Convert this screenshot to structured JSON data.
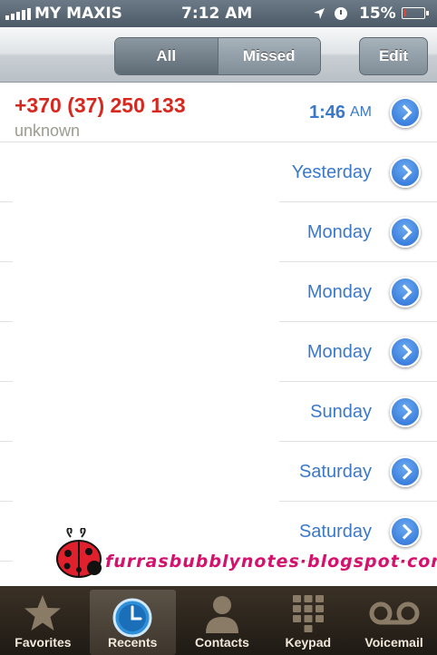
{
  "status": {
    "carrier": "MY MAXIS",
    "time": "7:12 AM",
    "battery": "15%",
    "battery_level": 0.15,
    "icons": [
      "signal-icon",
      "location-arrow-icon",
      "alarm-clock-icon",
      "battery-icon"
    ]
  },
  "nav": {
    "segments": [
      "All",
      "Missed"
    ],
    "selected": "All",
    "edit": "Edit"
  },
  "calls": [
    {
      "number": "+370 (37) 250 133",
      "label": "unknown",
      "time": "1:46",
      "ampm": "AM"
    },
    {
      "time": "Yesterday"
    },
    {
      "time": "Monday"
    },
    {
      "time": "Monday"
    },
    {
      "time": "Monday"
    },
    {
      "time": "Sunday"
    },
    {
      "time": "Saturday"
    },
    {
      "time": "Saturday"
    }
  ],
  "watermark": "furrasbubblynotes·blogspot·com",
  "tabs": [
    {
      "label": "Favorites",
      "icon": "star-icon"
    },
    {
      "label": "Recents",
      "icon": "clock-icon",
      "active": true
    },
    {
      "label": "Contacts",
      "icon": "contact-silhouette-icon"
    },
    {
      "label": "Keypad",
      "icon": "keypad-icon"
    },
    {
      "label": "Voicemail",
      "icon": "voicemail-icon"
    }
  ],
  "colors": {
    "missed_call_red": "#d7281f",
    "time_blue": "#3a78c9",
    "watermark_pink": "#d4116d"
  }
}
